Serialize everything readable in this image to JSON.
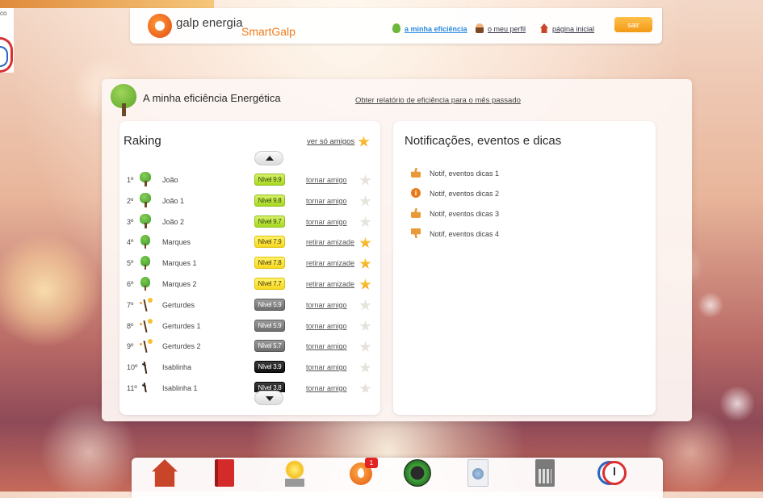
{
  "header": {
    "logo_text": "galp energia",
    "logo_sub": "SmartGalp",
    "nav": [
      {
        "label": "a minha eficiência",
        "icon": "tree-icon",
        "active": true
      },
      {
        "label": "o meu perfil",
        "icon": "person-icon",
        "active": false
      },
      {
        "label": "página inicial",
        "icon": "home-icon",
        "active": false
      }
    ],
    "exit_label": "sair"
  },
  "stray_text": "co",
  "panel": {
    "title": "A minha eficiência Energética",
    "report_link": "Obter relatório de eficiência para o mês passado"
  },
  "ranking": {
    "title": "Raking",
    "friends_link": "ver só amigos",
    "rows": [
      {
        "pos": "1º",
        "name": "João",
        "level": "Nível 9.9",
        "action": "tornar amigo",
        "friend": false,
        "avatar": "big-tree",
        "level_color": "green"
      },
      {
        "pos": "2º",
        "name": "João 1",
        "level": "Nível 9.8",
        "action": "tornar amigo",
        "friend": false,
        "avatar": "big-tree",
        "level_color": "green"
      },
      {
        "pos": "3º",
        "name": "João 2",
        "level": "Nível 9.7",
        "action": "tornar amigo",
        "friend": false,
        "avatar": "big-tree",
        "level_color": "green"
      },
      {
        "pos": "4º",
        "name": "Marques",
        "level": "Nível 7.9",
        "action": "retirar amizade",
        "friend": true,
        "avatar": "medium-tree",
        "level_color": "yellow"
      },
      {
        "pos": "5º",
        "name": "Marques 1",
        "level": "Nível 7.8",
        "action": "retirar amizade",
        "friend": true,
        "avatar": "medium-tree",
        "level_color": "yellow"
      },
      {
        "pos": "6º",
        "name": "Marques 2",
        "level": "Nível 7.7",
        "action": "retirar amizade",
        "friend": true,
        "avatar": "medium-tree",
        "level_color": "yellow"
      },
      {
        "pos": "7º",
        "name": "Gerturdes",
        "level": "Nível 5.9",
        "action": "tornar amigo",
        "friend": false,
        "avatar": "sprout",
        "level_color": "grey"
      },
      {
        "pos": "8º",
        "name": "Gerturdes 1",
        "level": "Nível 5.9",
        "action": "tornar amigo",
        "friend": false,
        "avatar": "sprout",
        "level_color": "grey"
      },
      {
        "pos": "9º",
        "name": "Gerturdes 2",
        "level": "Nível 5.7",
        "action": "tornar amigo",
        "friend": false,
        "avatar": "sprout",
        "level_color": "grey"
      },
      {
        "pos": "10º",
        "name": "Isablinha",
        "level": "Nível 3.9",
        "action": "tornar amigo",
        "friend": false,
        "avatar": "twig",
        "level_color": "black"
      },
      {
        "pos": "11º",
        "name": "Isablinha 1",
        "level": "Nível 3.8",
        "action": "tornar amigo",
        "friend": false,
        "avatar": "twig",
        "level_color": "black"
      }
    ]
  },
  "notifications": {
    "title": "Notificações, eventos e dicas",
    "items": [
      {
        "text": "Notif, eventos dicas 1",
        "icon": "thumbs-up-icon"
      },
      {
        "text": "Notif, eventos dicas 2",
        "icon": "info-icon"
      },
      {
        "text": "Notif, eventos dicas 3",
        "icon": "thumbs-up-icon"
      },
      {
        "text": "Notif, eventos dicas 4",
        "icon": "thumbs-down-icon"
      }
    ]
  },
  "dock": {
    "items": [
      {
        "icon": "house-icon"
      },
      {
        "icon": "book-icon"
      },
      {
        "icon": "lightbulb-icon"
      },
      {
        "icon": "flame-icon",
        "badge": "1"
      },
      {
        "icon": "gauge-icon"
      },
      {
        "icon": "washing-machine-icon"
      },
      {
        "icon": "calculator-icon"
      },
      {
        "icon": "stopwatch-icon"
      }
    ]
  },
  "colors": {
    "accent_orange": "#f39a16",
    "brand_orange": "#e24a0e",
    "active_link": "#2a8ae0",
    "badge_red": "#e22424"
  }
}
